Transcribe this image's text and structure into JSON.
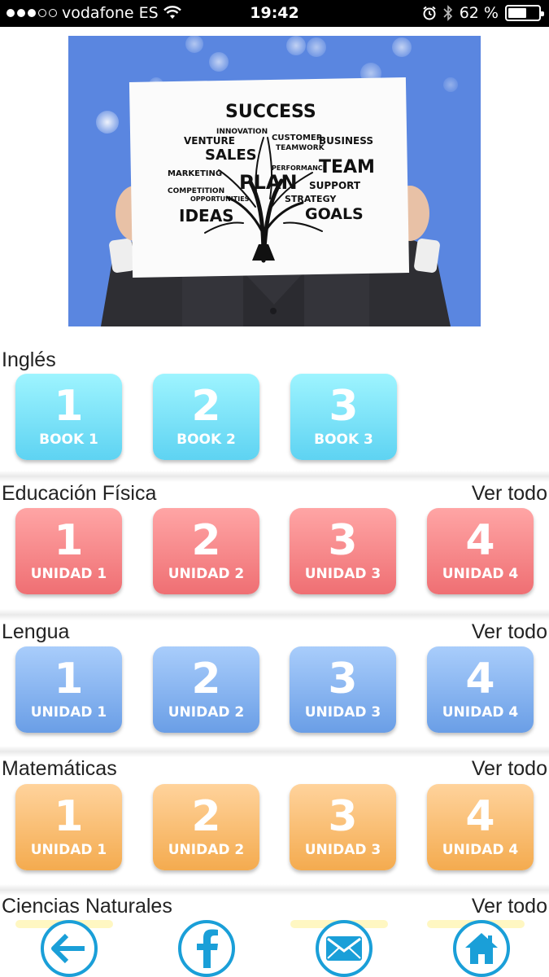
{
  "status_bar": {
    "carrier": "vodafone ES",
    "time": "19:42",
    "battery_text": "62 %",
    "battery_level": 0.62,
    "signal_bars_filled": 3,
    "signal_bars_total": 5
  },
  "hero": {
    "words": [
      "SUCCESS",
      "INNOVATION",
      "CUSTOMER",
      "VENTURE",
      "SALES",
      "TEAMWORK",
      "BUSINESS",
      "MARKETING",
      "PERFORMANCE",
      "TEAM",
      "PLAN",
      "COMPETITION",
      "SUPPORT",
      "OPPORTUNITIES",
      "STRATEGY",
      "IDEAS",
      "GOALS"
    ]
  },
  "sections": [
    {
      "title": "Inglés",
      "see_all": "",
      "color": "#5ed3f2",
      "tiles": [
        {
          "num": "1",
          "label": "BOOK 1"
        },
        {
          "num": "2",
          "label": "BOOK 2"
        },
        {
          "num": "3",
          "label": "BOOK 3"
        }
      ]
    },
    {
      "title": "Educación Física",
      "see_all": "Ver todo",
      "color": "#ef6f73",
      "tiles": [
        {
          "num": "1",
          "label": "UNIDAD 1"
        },
        {
          "num": "2",
          "label": "UNIDAD 2"
        },
        {
          "num": "3",
          "label": "UNIDAD 3"
        },
        {
          "num": "4",
          "label": "UNIDAD 4"
        }
      ]
    },
    {
      "title": "Lengua",
      "see_all": "Ver todo",
      "color": "#6a9ee6",
      "tiles": [
        {
          "num": "1",
          "label": "UNIDAD 1"
        },
        {
          "num": "2",
          "label": "UNIDAD 2"
        },
        {
          "num": "3",
          "label": "UNIDAD 3"
        },
        {
          "num": "4",
          "label": "UNIDAD 4"
        }
      ]
    },
    {
      "title": "Matemáticas",
      "see_all": "Ver todo",
      "color": "#f4ab4f",
      "tiles": [
        {
          "num": "1",
          "label": "UNIDAD 1"
        },
        {
          "num": "2",
          "label": "UNIDAD 2"
        },
        {
          "num": "3",
          "label": "UNIDAD 3"
        },
        {
          "num": "4",
          "label": "UNIDAD 4"
        }
      ]
    },
    {
      "title": "Ciencias Naturales",
      "see_all": "Ver todo"
    }
  ],
  "bottom_nav": {
    "color": "#1a9fd8",
    "items": [
      {
        "icon": "back-arrow-icon"
      },
      {
        "icon": "facebook-icon"
      },
      {
        "icon": "mail-icon"
      },
      {
        "icon": "home-icon"
      }
    ]
  }
}
